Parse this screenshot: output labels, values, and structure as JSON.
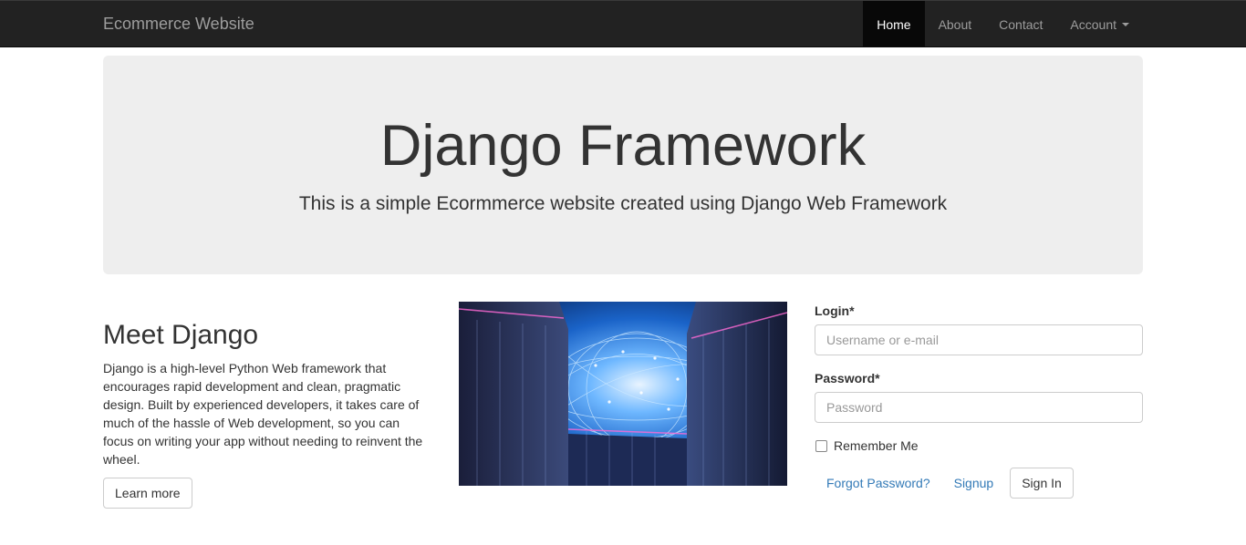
{
  "navbar": {
    "brand": "Ecommerce Website",
    "items": [
      {
        "label": "Home"
      },
      {
        "label": "About"
      },
      {
        "label": "Contact"
      },
      {
        "label": "Account"
      }
    ]
  },
  "jumbotron": {
    "title": "Django Framework",
    "subtitle": "This is a simple Ecormmerce website created using Django Web Framework"
  },
  "intro": {
    "heading": "Meet Django",
    "body": "Django is a high-level Python Web framework that encourages rapid development and clean, pragmatic design. Built by experienced developers, it takes care of much of the hassle of Web development, so you can focus on writing your app without needing to reinvent the wheel.",
    "button": "Learn more"
  },
  "login_form": {
    "login_label": "Login*",
    "login_placeholder": "Username or e-mail",
    "login_value": "",
    "password_label": "Password*",
    "password_placeholder": "Password",
    "password_value": "",
    "remember_label": "Remember Me",
    "remember_checked": false,
    "forgot_link": "Forgot Password?",
    "signup_link": "Signup",
    "signin_button": "Sign In"
  },
  "colors": {
    "navbar_bg": "#222222",
    "active_bg": "#080808",
    "jumbotron_bg": "#eeeeee",
    "link": "#337ab7"
  }
}
